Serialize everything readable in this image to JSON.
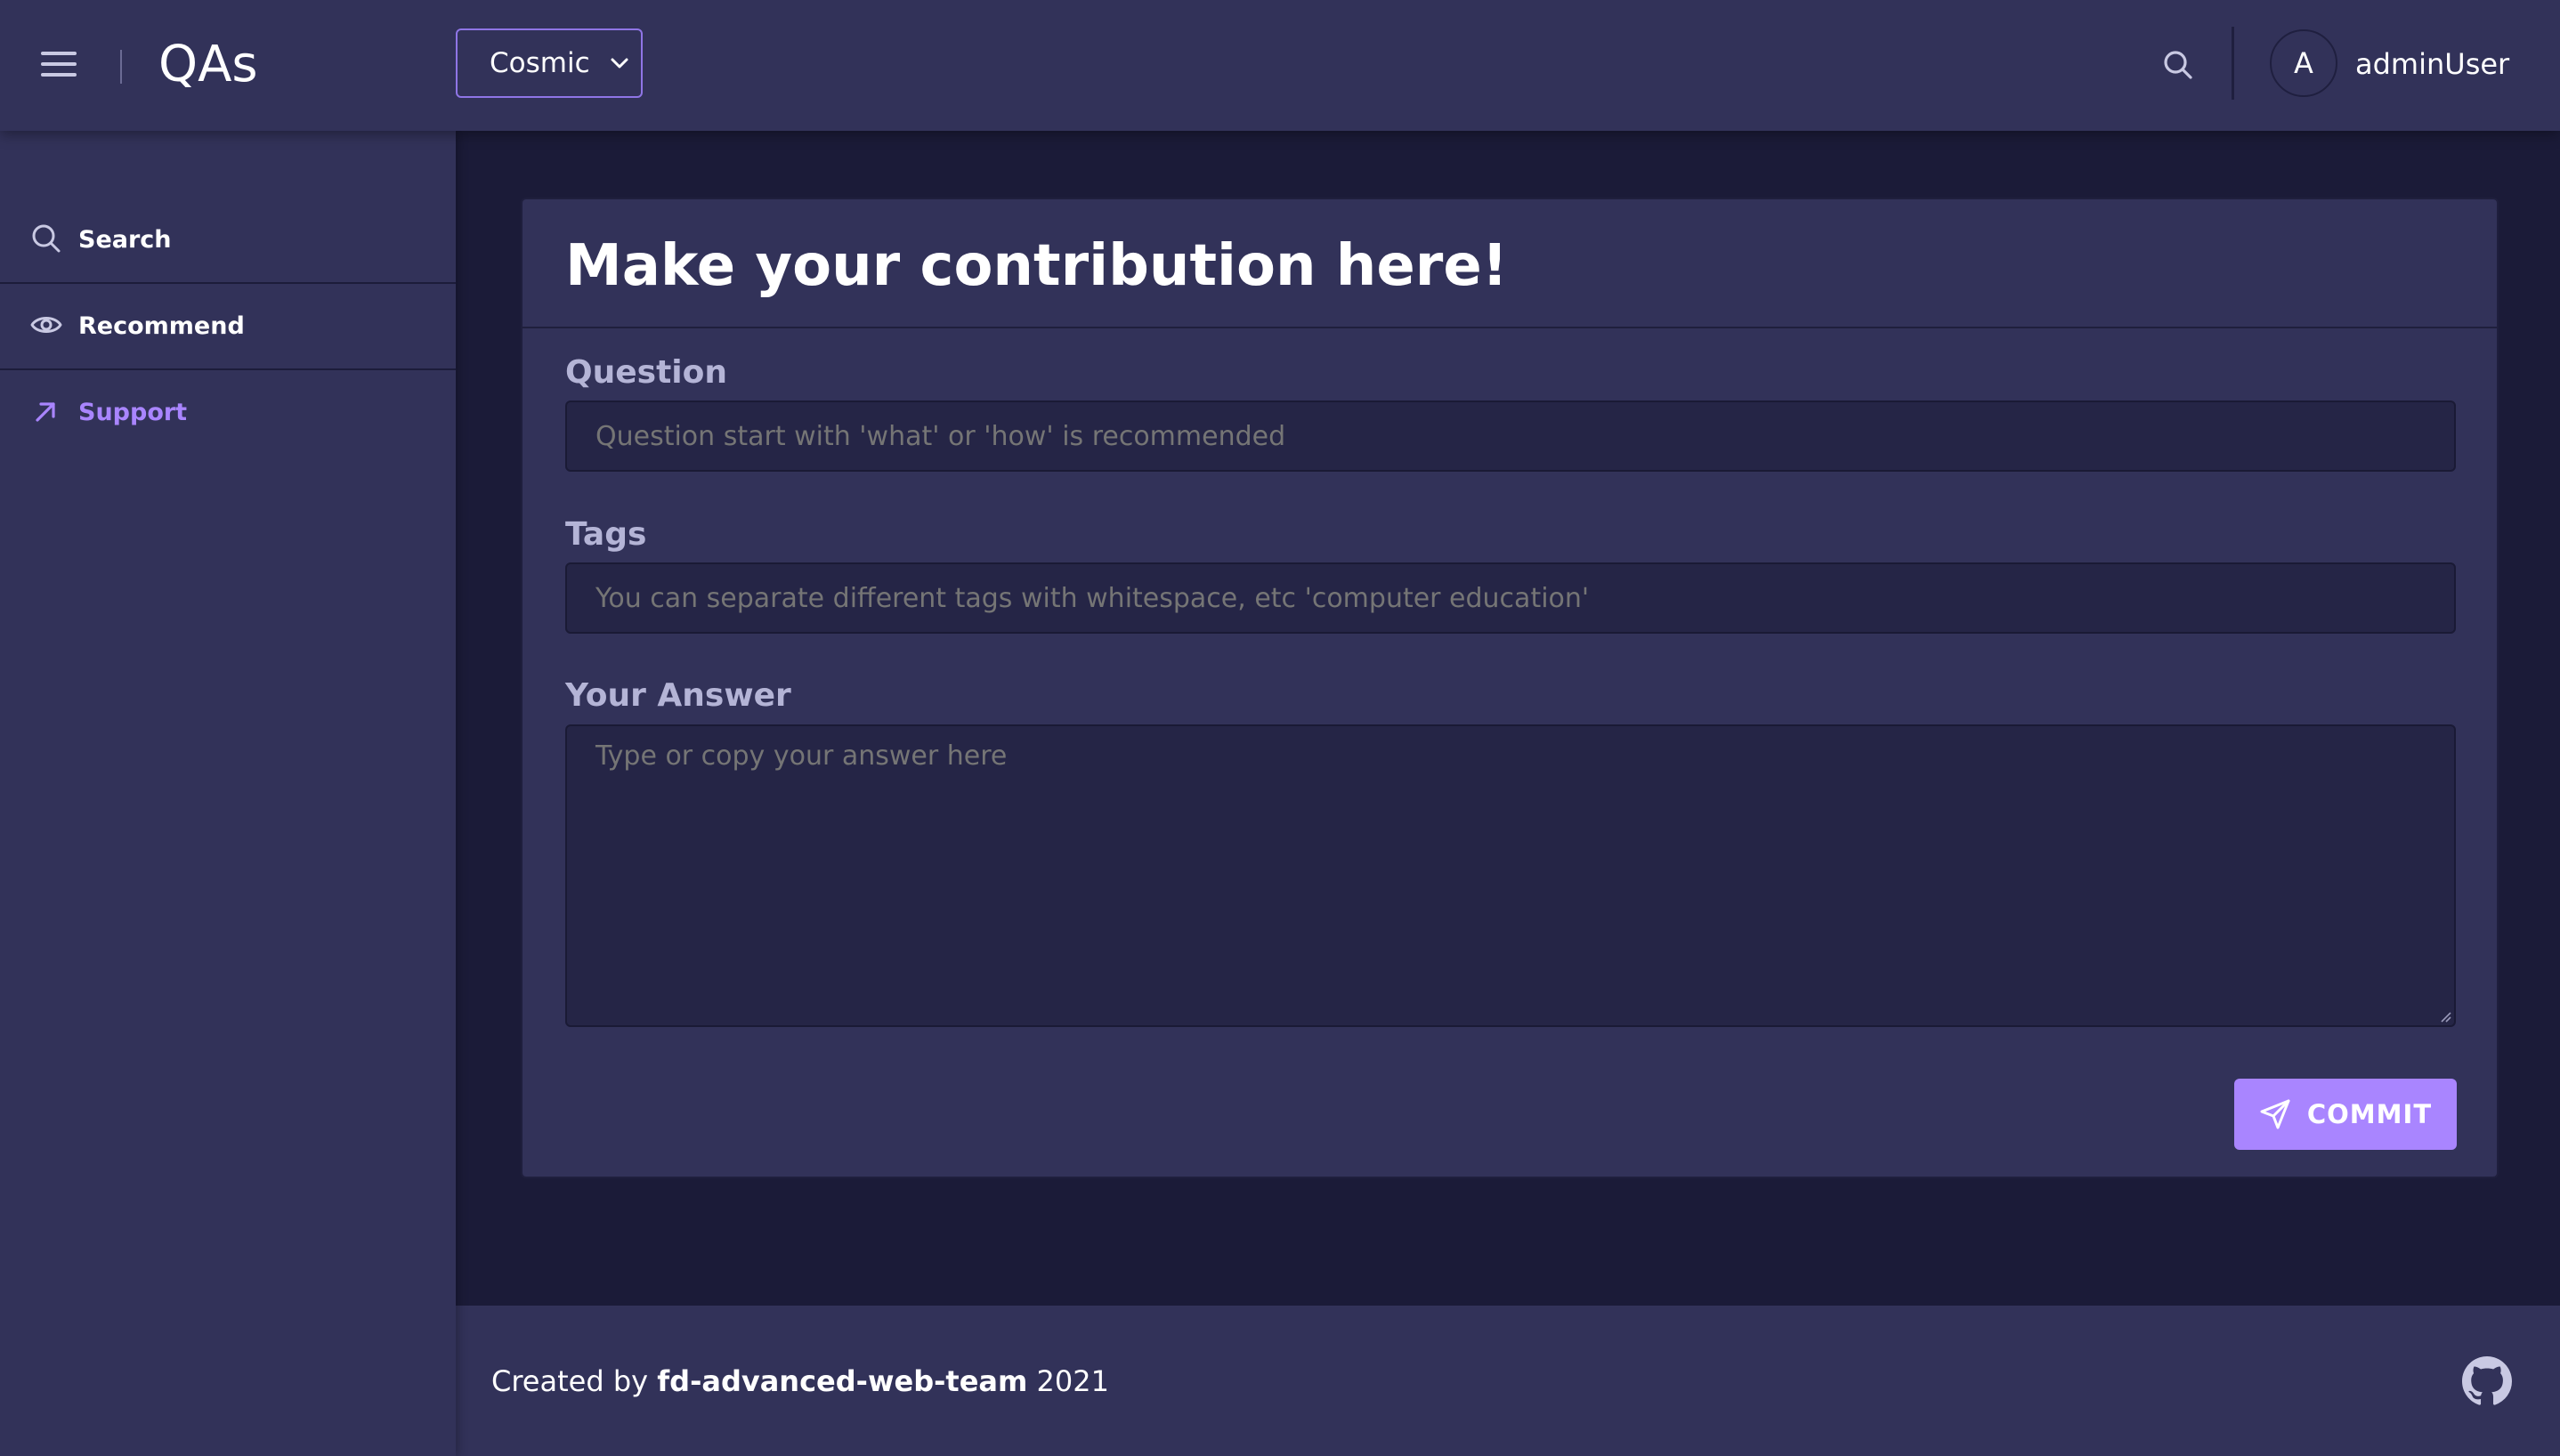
{
  "header": {
    "app_title": "QAs",
    "theme_select": {
      "value": "Cosmic"
    },
    "user": {
      "avatar_initial": "A",
      "name": "adminUser"
    }
  },
  "sidebar": {
    "items": [
      {
        "label": "Search",
        "icon": "search-icon",
        "active": false
      },
      {
        "label": "Recommend",
        "icon": "eye-icon",
        "active": false
      },
      {
        "label": "Support",
        "icon": "arrow-up-right-icon",
        "active": true
      }
    ]
  },
  "form": {
    "title": "Make your contribution here!",
    "question": {
      "label": "Question",
      "placeholder": "Question start with 'what' or 'how' is recommended",
      "value": ""
    },
    "tags": {
      "label": "Tags",
      "placeholder": "You can separate different tags with whitespace, etc 'computer education'",
      "value": ""
    },
    "answer": {
      "label": "Your Answer",
      "placeholder": "Type or copy your answer here",
      "value": ""
    },
    "commit_label": "COMMIT"
  },
  "footer": {
    "prefix": "Created by",
    "team": "fd-advanced-web-team",
    "year": "2021",
    "icon": "github-icon"
  },
  "colors": {
    "accent": "#a985ff",
    "surface": "#323259",
    "background": "#1b1b38",
    "input_bg": "#252546",
    "label_muted": "#b4b4d6"
  }
}
